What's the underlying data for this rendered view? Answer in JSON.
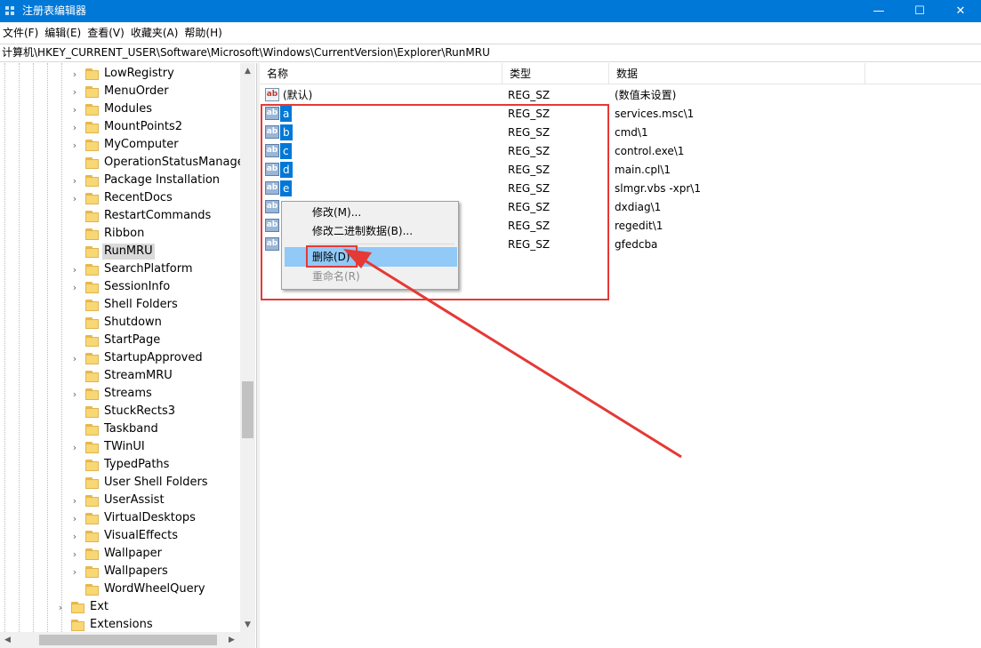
{
  "window": {
    "title": "注册表编辑器",
    "controls": {
      "minimize": "—",
      "maximize": "☐",
      "close": "✕"
    }
  },
  "menu": [
    "文件(F)",
    "编辑(E)",
    "查看(V)",
    "收藏夹(A)",
    "帮助(H)"
  ],
  "address": "计算机\\HKEY_CURRENT_USER\\Software\\Microsoft\\Windows\\CurrentVersion\\Explorer\\RunMRU",
  "tree": {
    "items": [
      {
        "label": "LowRegistry",
        "expandable": true
      },
      {
        "label": "MenuOrder",
        "expandable": true
      },
      {
        "label": "Modules",
        "expandable": true
      },
      {
        "label": "MountPoints2",
        "expandable": true
      },
      {
        "label": "MyComputer",
        "expandable": true
      },
      {
        "label": "OperationStatusManager",
        "expandable": false
      },
      {
        "label": "Package Installation",
        "expandable": true
      },
      {
        "label": "RecentDocs",
        "expandable": true
      },
      {
        "label": "RestartCommands",
        "expandable": false
      },
      {
        "label": "Ribbon",
        "expandable": false
      },
      {
        "label": "RunMRU",
        "expandable": false,
        "selected": true
      },
      {
        "label": "SearchPlatform",
        "expandable": true
      },
      {
        "label": "SessionInfo",
        "expandable": true
      },
      {
        "label": "Shell Folders",
        "expandable": false
      },
      {
        "label": "Shutdown",
        "expandable": false
      },
      {
        "label": "StartPage",
        "expandable": false
      },
      {
        "label": "StartupApproved",
        "expandable": true
      },
      {
        "label": "StreamMRU",
        "expandable": false
      },
      {
        "label": "Streams",
        "expandable": true
      },
      {
        "label": "StuckRects3",
        "expandable": false
      },
      {
        "label": "Taskband",
        "expandable": false
      },
      {
        "label": "TWinUI",
        "expandable": true
      },
      {
        "label": "TypedPaths",
        "expandable": false
      },
      {
        "label": "User Shell Folders",
        "expandable": false
      },
      {
        "label": "UserAssist",
        "expandable": true
      },
      {
        "label": "VirtualDesktops",
        "expandable": true
      },
      {
        "label": "VisualEffects",
        "expandable": true
      },
      {
        "label": "Wallpaper",
        "expandable": true
      },
      {
        "label": "Wallpapers",
        "expandable": true
      },
      {
        "label": "WordWheelQuery",
        "expandable": false
      }
    ],
    "parent_items": [
      {
        "label": "Ext",
        "expandable": true
      },
      {
        "label": "Extensions",
        "expandable": false
      }
    ]
  },
  "list": {
    "columns": [
      "名称",
      "类型",
      "数据"
    ],
    "rows": [
      {
        "name": "(默认)",
        "type": "REG_SZ",
        "data": "(数值未设置)",
        "selected": false
      },
      {
        "name": "a",
        "type": "REG_SZ",
        "data": "services.msc\\1",
        "selected": true
      },
      {
        "name": "b",
        "type": "REG_SZ",
        "data": "cmd\\1",
        "selected": true
      },
      {
        "name": "c",
        "type": "REG_SZ",
        "data": "control.exe\\1",
        "selected": true
      },
      {
        "name": "d",
        "type": "REG_SZ",
        "data": "main.cpl\\1",
        "selected": true
      },
      {
        "name": "e",
        "type": "REG_SZ",
        "data": "slmgr.vbs -xpr\\1",
        "selected": true
      },
      {
        "name": "",
        "type": "REG_SZ",
        "data": "dxdiag\\1",
        "selected": true
      },
      {
        "name": "",
        "type": "REG_SZ",
        "data": "regedit\\1",
        "selected": true
      },
      {
        "name": "",
        "type": "REG_SZ",
        "data": "gfedcba",
        "selected": true
      }
    ],
    "icon_text": "ab"
  },
  "context_menu": {
    "items": [
      {
        "label": "修改(M)...",
        "enabled": true,
        "highlighted": false
      },
      {
        "label": "修改二进制数据(B)...",
        "enabled": true,
        "highlighted": false
      },
      {
        "label": "删除(D)",
        "enabled": true,
        "highlighted": true
      },
      {
        "label": "重命名(R)",
        "enabled": false,
        "highlighted": false
      }
    ]
  },
  "colors": {
    "titlebar": "#0078d7",
    "selection": "#0078d7",
    "menu_highlight": "#91c9f7",
    "annotation": "#e53935"
  }
}
